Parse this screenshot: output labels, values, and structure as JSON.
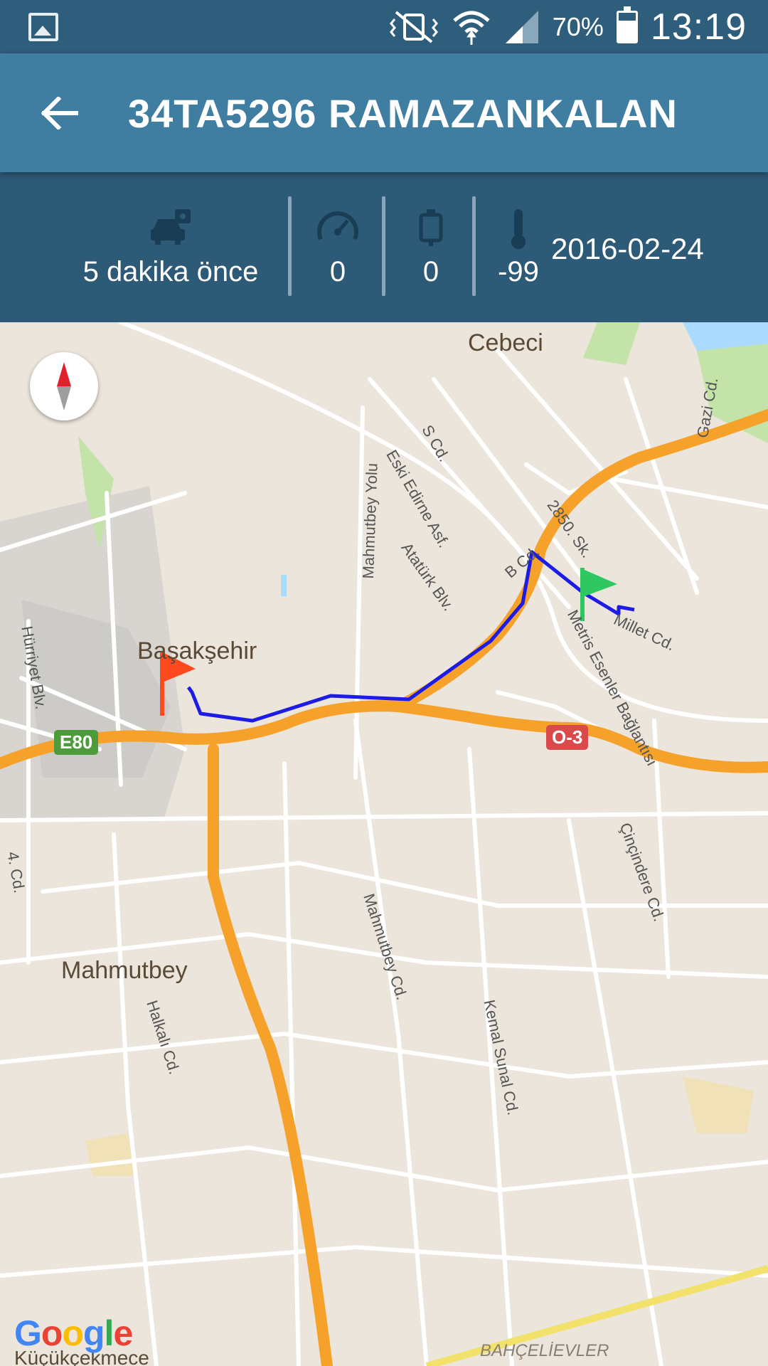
{
  "status_bar": {
    "battery_percent": "70%",
    "time": "13:19",
    "icons": [
      "gallery-icon",
      "vibrate-mute-icon",
      "wifi-icon",
      "signal-icon",
      "battery-icon"
    ]
  },
  "app_bar": {
    "back_icon": "arrow-back-icon",
    "title": "34TA5296 RAMAZANKALAN"
  },
  "info": {
    "last_update": "5 dakika önce",
    "speed": "0",
    "fuel": "0",
    "temperature": "-99",
    "date": "2016-02-24",
    "icons": [
      "car-gps-icon",
      "speedometer-icon",
      "fuel-icon",
      "thermometer-icon"
    ]
  },
  "map": {
    "places": {
      "cebeci": "Cebeci",
      "basaksehir": "Başakşehir",
      "mahmutbey": "Mahmutbey",
      "kucukcekmece": "Küçükçekmece",
      "bahcelievler": "BAHÇELİEVLER"
    },
    "streets": {
      "s_cd": "S Cd.",
      "gazi_cd": "Gazi Cd.",
      "eski_edirne": "Eski Edirne Asf.",
      "sk_2850": "2850. Sk.",
      "mahmutbey_yolu": "Mahmutbey Yolu",
      "ataturk_blv": "Atatürk Blv.",
      "b_cd": "B Cd.",
      "millet_cd": "Millet Cd.",
      "metris": "Metris Esenler Bağlantısı",
      "hurriyet_blv": "Hürriyet Blv.",
      "mahmutbey_cd": "Mahmutbey Cd.",
      "cincindere_cd": "Çinçindere Cd.",
      "cd_4": "4. Cd.",
      "halkali_cd": "Halkalı Cd.",
      "kemal_sunal_cd": "Kemal Sunal Cd."
    },
    "shields": {
      "e80": "E80",
      "o3": "O-3"
    },
    "colors": {
      "route": "#1c1ce6",
      "highway": "#f6a12a",
      "start_flag": "#ff4a1f",
      "end_flag": "#2ec760"
    },
    "attribution": {
      "g1": "G",
      "o1": "o",
      "o2": "o",
      "g2": "g",
      "l": "l",
      "e": "e"
    }
  }
}
